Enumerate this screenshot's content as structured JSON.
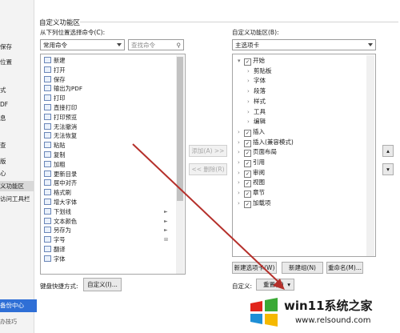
{
  "nav": {
    "items": [
      "保存",
      "位置",
      "式",
      "DF",
      "息",
      "查",
      "版",
      "心",
      "义功能区",
      "访问工具栏"
    ],
    "backup_label": "备份中心",
    "tips_label": "办技巧",
    "selected_index": 8
  },
  "left_panel": {
    "heading": "自定义功能区",
    "choose_label": "从下列位置选择命令(C):",
    "source_select": "常用命令",
    "search_placeholder": "查找命令",
    "commands": [
      {
        "label": "新建",
        "icon": "new-doc-icon"
      },
      {
        "label": "打开",
        "icon": "open-folder-icon"
      },
      {
        "label": "保存",
        "icon": "save-icon"
      },
      {
        "label": "输出为PDF",
        "icon": "pdf-icon"
      },
      {
        "label": "打印",
        "icon": "print-icon"
      },
      {
        "label": "直接打印",
        "icon": "direct-print-icon"
      },
      {
        "label": "打印预览",
        "icon": "print-preview-icon"
      },
      {
        "label": "无法撤消",
        "icon": "undo-icon"
      },
      {
        "label": "无法恢复",
        "icon": "redo-icon"
      },
      {
        "label": "粘贴",
        "icon": "paste-icon"
      },
      {
        "label": "复制",
        "icon": "copy-icon"
      },
      {
        "label": "加粗",
        "icon": "bold-icon"
      },
      {
        "label": "更新目录",
        "icon": "update-toc-icon"
      },
      {
        "label": "居中对齐",
        "icon": "align-center-icon"
      },
      {
        "label": "格式刷",
        "icon": "format-painter-icon"
      },
      {
        "label": "增大字体",
        "icon": "font-grow-icon"
      },
      {
        "label": "下划线",
        "icon": "underline-icon",
        "sub": "►"
      },
      {
        "label": "文本颜色",
        "icon": "font-color-icon",
        "sub": "►"
      },
      {
        "label": "另存为",
        "icon": "save-as-icon",
        "sub": "►"
      },
      {
        "label": "字号",
        "icon": "font-size-icon",
        "sub": "⊞"
      },
      {
        "label": "翻译",
        "icon": "translate-icon"
      },
      {
        "label": "字体",
        "icon": "font-icon"
      }
    ],
    "shortcut_label": "键盘快捷方式:",
    "shortcut_button": "自定义(I)..."
  },
  "middle": {
    "add_button": "添加(A) >>",
    "remove_button": "<< 删除(R)"
  },
  "right_panel": {
    "heading": "自定义功能区(B):",
    "tabs_select": "主选项卡",
    "tree": [
      {
        "label": "开始",
        "level": 0,
        "expander": "▾",
        "checked": true
      },
      {
        "label": "剪贴板",
        "level": 1,
        "expander": "›",
        "checked": null
      },
      {
        "label": "字体",
        "level": 1,
        "expander": "›",
        "checked": null
      },
      {
        "label": "段落",
        "level": 1,
        "expander": "›",
        "checked": null
      },
      {
        "label": "样式",
        "level": 1,
        "expander": "›",
        "checked": null
      },
      {
        "label": "工具",
        "level": 1,
        "expander": "›",
        "checked": null
      },
      {
        "label": "编辑",
        "level": 1,
        "expander": "›",
        "checked": null
      },
      {
        "label": "插入",
        "level": 0,
        "expander": "›",
        "checked": true
      },
      {
        "label": "插入(兼容模式)",
        "level": 0,
        "expander": "›",
        "checked": true
      },
      {
        "label": "页面布局",
        "level": 0,
        "expander": "›",
        "checked": true
      },
      {
        "label": "引用",
        "level": 0,
        "expander": "›",
        "checked": true
      },
      {
        "label": "审阅",
        "level": 0,
        "expander": "›",
        "checked": true
      },
      {
        "label": "视图",
        "level": 0,
        "expander": "›",
        "checked": true
      },
      {
        "label": "章节",
        "level": 0,
        "expander": "›",
        "checked": true
      },
      {
        "label": "加载项",
        "level": 0,
        "expander": "›",
        "checked": true
      }
    ],
    "new_tab_button": "新建选项卡(W)",
    "new_group_button": "新建组(N)",
    "rename_button": "重命名(M)...",
    "customize_label": "自定义:",
    "reset_button": "重置(E)",
    "move_up": "▴",
    "move_down": "▾"
  },
  "watermark": {
    "brand": "win11系统之家",
    "url": "www.relsound.com"
  },
  "colors": {
    "accent": "#2f6fd6",
    "annotation_arrow": "#b5302b",
    "logo_red": "#e1251b",
    "logo_green": "#3aa935",
    "logo_yellow": "#f5b800",
    "logo_blue": "#1e8fd6"
  }
}
